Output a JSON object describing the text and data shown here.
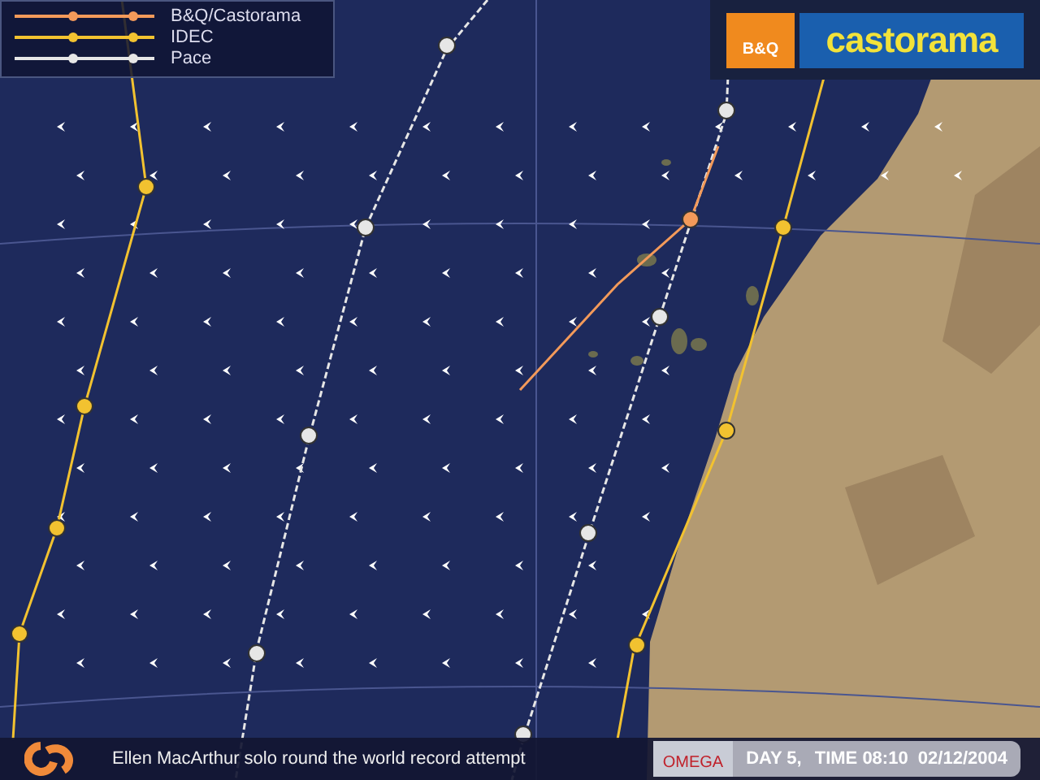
{
  "legend": [
    {
      "name": "B&Q/Castorama",
      "color": "#f39a5a"
    },
    {
      "name": "IDEC",
      "color": "#f2c230"
    },
    {
      "name": "Pace",
      "color": "#e6e6e6"
    }
  ],
  "sponsor_logo": {
    "square_text": "B&Q",
    "banner_text": "castorama"
  },
  "bottom_bar": {
    "caption": "Ellen MacArthur solo round the world record attempt",
    "watch_brand": "OMEGA",
    "day": "DAY 5,",
    "time": "TIME 08:10  02/12/2004"
  }
}
